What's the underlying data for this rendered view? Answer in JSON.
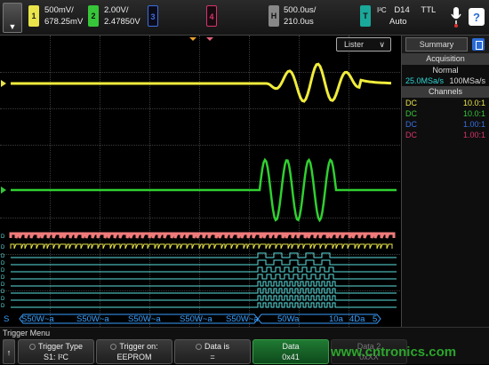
{
  "topbar": {
    "menu_glyph": "▼",
    "ch1": {
      "num": "1",
      "scale": "500mV/",
      "offset": "678.25mV",
      "color": "#e8e44a"
    },
    "ch2": {
      "num": "2",
      "scale": "2.00V/",
      "offset": "2.47850V",
      "color": "#37c63a"
    },
    "ch3": {
      "num": "3",
      "color": "#3b6fe0"
    },
    "ch4": {
      "num": "4",
      "color": "#d8346d"
    },
    "horizontal": {
      "label": "H",
      "timebase": "500.0us/",
      "delay": "210.0us"
    },
    "trigger": {
      "label": "T",
      "type": "I²C",
      "source": "D14",
      "level": "TTL",
      "mode": "Auto"
    }
  },
  "screen": {
    "lister_label": "Lister",
    "lister_chev": "∨",
    "bus_segments": [
      "S50W~a",
      "S50W~a",
      "S50W~a",
      "S50W~a",
      "S50W~a",
      "50Wa",
      "10a",
      "4Da",
      "5"
    ],
    "bus_prefix": "S"
  },
  "panel": {
    "summary_tab": "Summary",
    "acquisition_header": "Acquisition",
    "acq_mode": "Normal",
    "sample_rate": "25.0MSa/s",
    "max_rate": "100MSa/s",
    "channels_header": "Channels",
    "channels": [
      {
        "coupling": "DC",
        "ratio": "10.0:1",
        "color": "#e8e44a"
      },
      {
        "coupling": "DC",
        "ratio": "10.0:1",
        "color": "#37c63a"
      },
      {
        "coupling": "DC",
        "ratio": "1.00:1",
        "color": "#3b6fe0"
      },
      {
        "coupling": "DC",
        "ratio": "1.00:1",
        "color": "#d8346d"
      }
    ]
  },
  "bottom": {
    "menu_title": "Trigger Menu",
    "back_glyph": "↑",
    "softkeys": [
      {
        "label": "Trigger Type",
        "value": "S1: I²C"
      },
      {
        "label": "Trigger on:",
        "value": "EEPROM"
      },
      {
        "label": "Data is",
        "value": "="
      },
      {
        "label": "Data",
        "value": "0x41"
      },
      {
        "label": "Data 2",
        "value": "0xXX"
      }
    ]
  },
  "watermark": "www.cntronics.com"
}
